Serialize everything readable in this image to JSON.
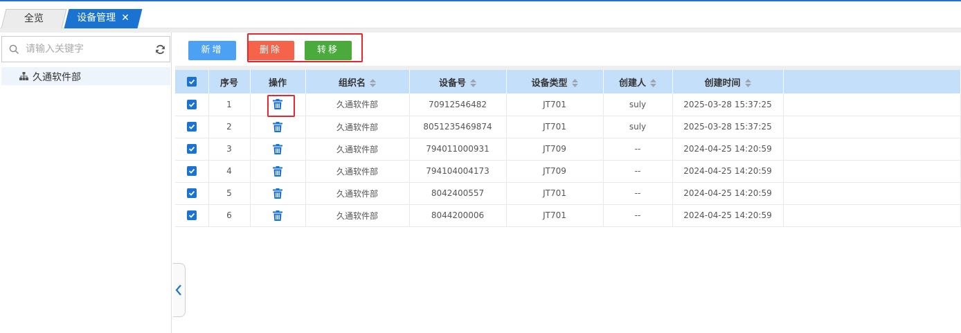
{
  "tabs": {
    "home_label": "全览",
    "active_label": "设备管理",
    "close_symbol": "✕"
  },
  "sidebar": {
    "search_placeholder": "请输入关键字",
    "tree_root_label": "久通软件部"
  },
  "toolbar": {
    "add_label": "新增",
    "delete_label": "删除",
    "transfer_label": "转移"
  },
  "table": {
    "headers": {
      "index": "序号",
      "action": "操作",
      "org_name": "组织名",
      "device_no": "设备号",
      "device_type": "设备类型",
      "creator": "创建人",
      "created_time": "创建时间"
    },
    "rows": [
      {
        "index": "1",
        "org_name": "久通软件部",
        "device_no": "70912546482",
        "device_type": "JT701",
        "creator": "suly",
        "created_time": "2025-03-28 15:37:25",
        "checked": true
      },
      {
        "index": "2",
        "org_name": "久通软件部",
        "device_no": "8051235469874",
        "device_type": "JT701",
        "creator": "suly",
        "created_time": "2025-03-28 15:37:25",
        "checked": true
      },
      {
        "index": "3",
        "org_name": "久通软件部",
        "device_no": "794011000931",
        "device_type": "JT709",
        "creator": "--",
        "created_time": "2024-04-25 14:20:59",
        "checked": true
      },
      {
        "index": "4",
        "org_name": "久通软件部",
        "device_no": "794104004173",
        "device_type": "JT709",
        "creator": "--",
        "created_time": "2024-04-25 14:20:59",
        "checked": true
      },
      {
        "index": "5",
        "org_name": "久通软件部",
        "device_no": "8042400557",
        "device_type": "JT701",
        "creator": "--",
        "created_time": "2024-04-25 14:20:59",
        "checked": true
      },
      {
        "index": "6",
        "org_name": "久通软件部",
        "device_no": "8044200006",
        "device_type": "JT701",
        "creator": "--",
        "created_time": "2024-04-25 14:20:59",
        "checked": true
      }
    ]
  },
  "colors": {
    "accent": "#1a73d1",
    "add_button": "#4da1f5",
    "delete_button": "#f5634a",
    "transfer_button": "#4aaa3c",
    "header_bg": "#c4dff9",
    "highlight": "#e8262b"
  },
  "icons": {
    "search": "search-icon",
    "refresh": "refresh-icon",
    "tree": "org-tree-icon",
    "delete_row": "trash-icon",
    "sort": "sort-icon",
    "collapse": "chevron-left-icon"
  }
}
